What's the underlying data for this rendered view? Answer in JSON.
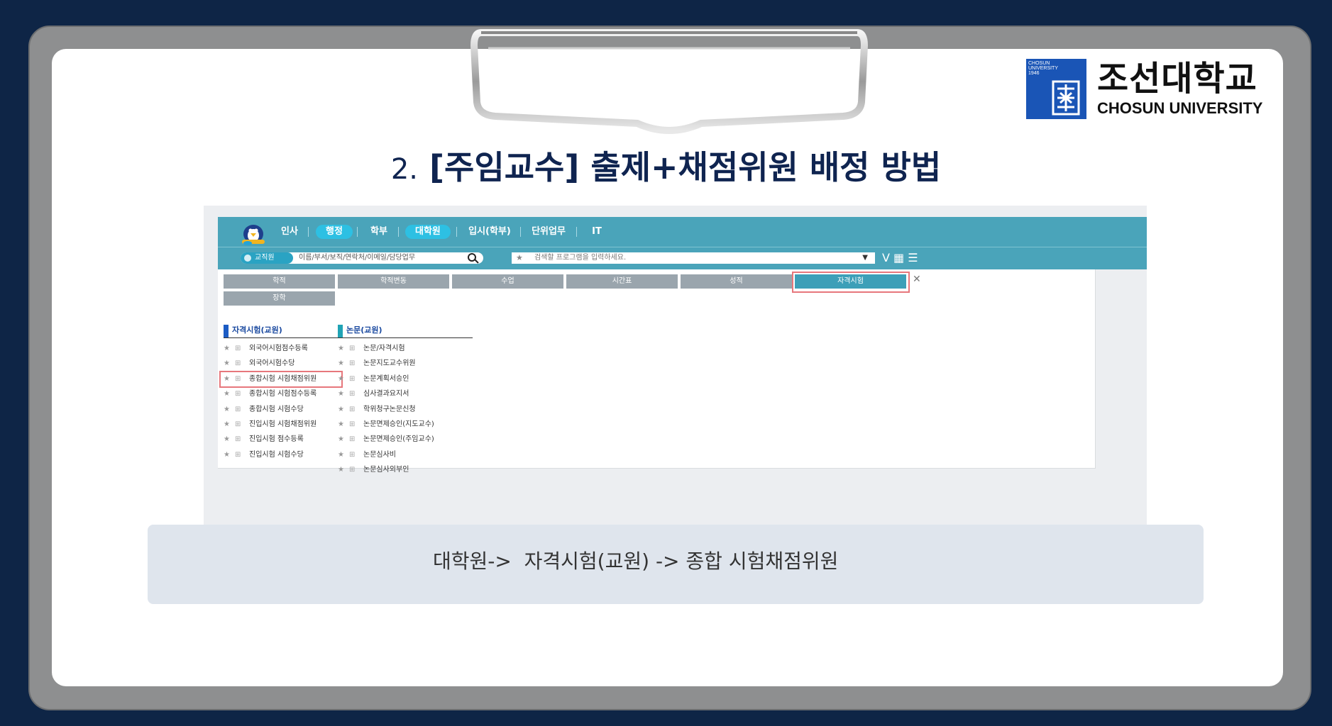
{
  "logo": {
    "small_text": [
      "CHOSUN",
      "UNIVERSITY",
      "1946"
    ],
    "name_kr": "조선대학교",
    "name_en": "CHOSUN UNIVERSITY"
  },
  "title": {
    "number": "2.",
    "text": "[주임교수] 출제+채점위원 배정 방법"
  },
  "nav": {
    "items": [
      "인사",
      "행정",
      "학부",
      "대학원",
      "입시(학부)",
      "단위업무",
      "IT"
    ],
    "active": [
      "행정",
      "대학원"
    ]
  },
  "search": {
    "employee_tag": "교직원",
    "employee_placeholder": "이름/부서/보직/연락처/이메일/담당업무",
    "program_placeholder": "검색할 프로그램을 입력하세요.",
    "program_star": "★",
    "dropdown_icon": "▼",
    "tools": "V ▦ ☰"
  },
  "tabs": [
    "학적",
    "학적변동",
    "수업",
    "시간표",
    "성적",
    "자격시험",
    "장학"
  ],
  "active_tab": "자격시험",
  "close_label": "✕",
  "columns": [
    {
      "heading": "자격시험(교원)",
      "items": [
        "외국어시험점수등록",
        "외국어시험수당",
        "종합시험 시험채점위원",
        "종합시험 시험점수등록",
        "종합시험 시험수당",
        "진입시험 시험채점위원",
        "진입시험 점수등록",
        "진입시험 시험수당"
      ],
      "highlighted": "종합시험 시험채점위원"
    },
    {
      "heading": "논문(교원)",
      "items": [
        "논문/자격시험",
        "논문지도교수위원",
        "논문계획서승인",
        "심사결과요지서",
        "학위청구논문신청",
        "논문면제승인(지도교수)",
        "논문면제승인(주임교수)",
        "논문심사비",
        "논문심사외부인"
      ]
    }
  ],
  "caption": "대학원->  자격시험(교원) -> 종합 시험채점위원"
}
